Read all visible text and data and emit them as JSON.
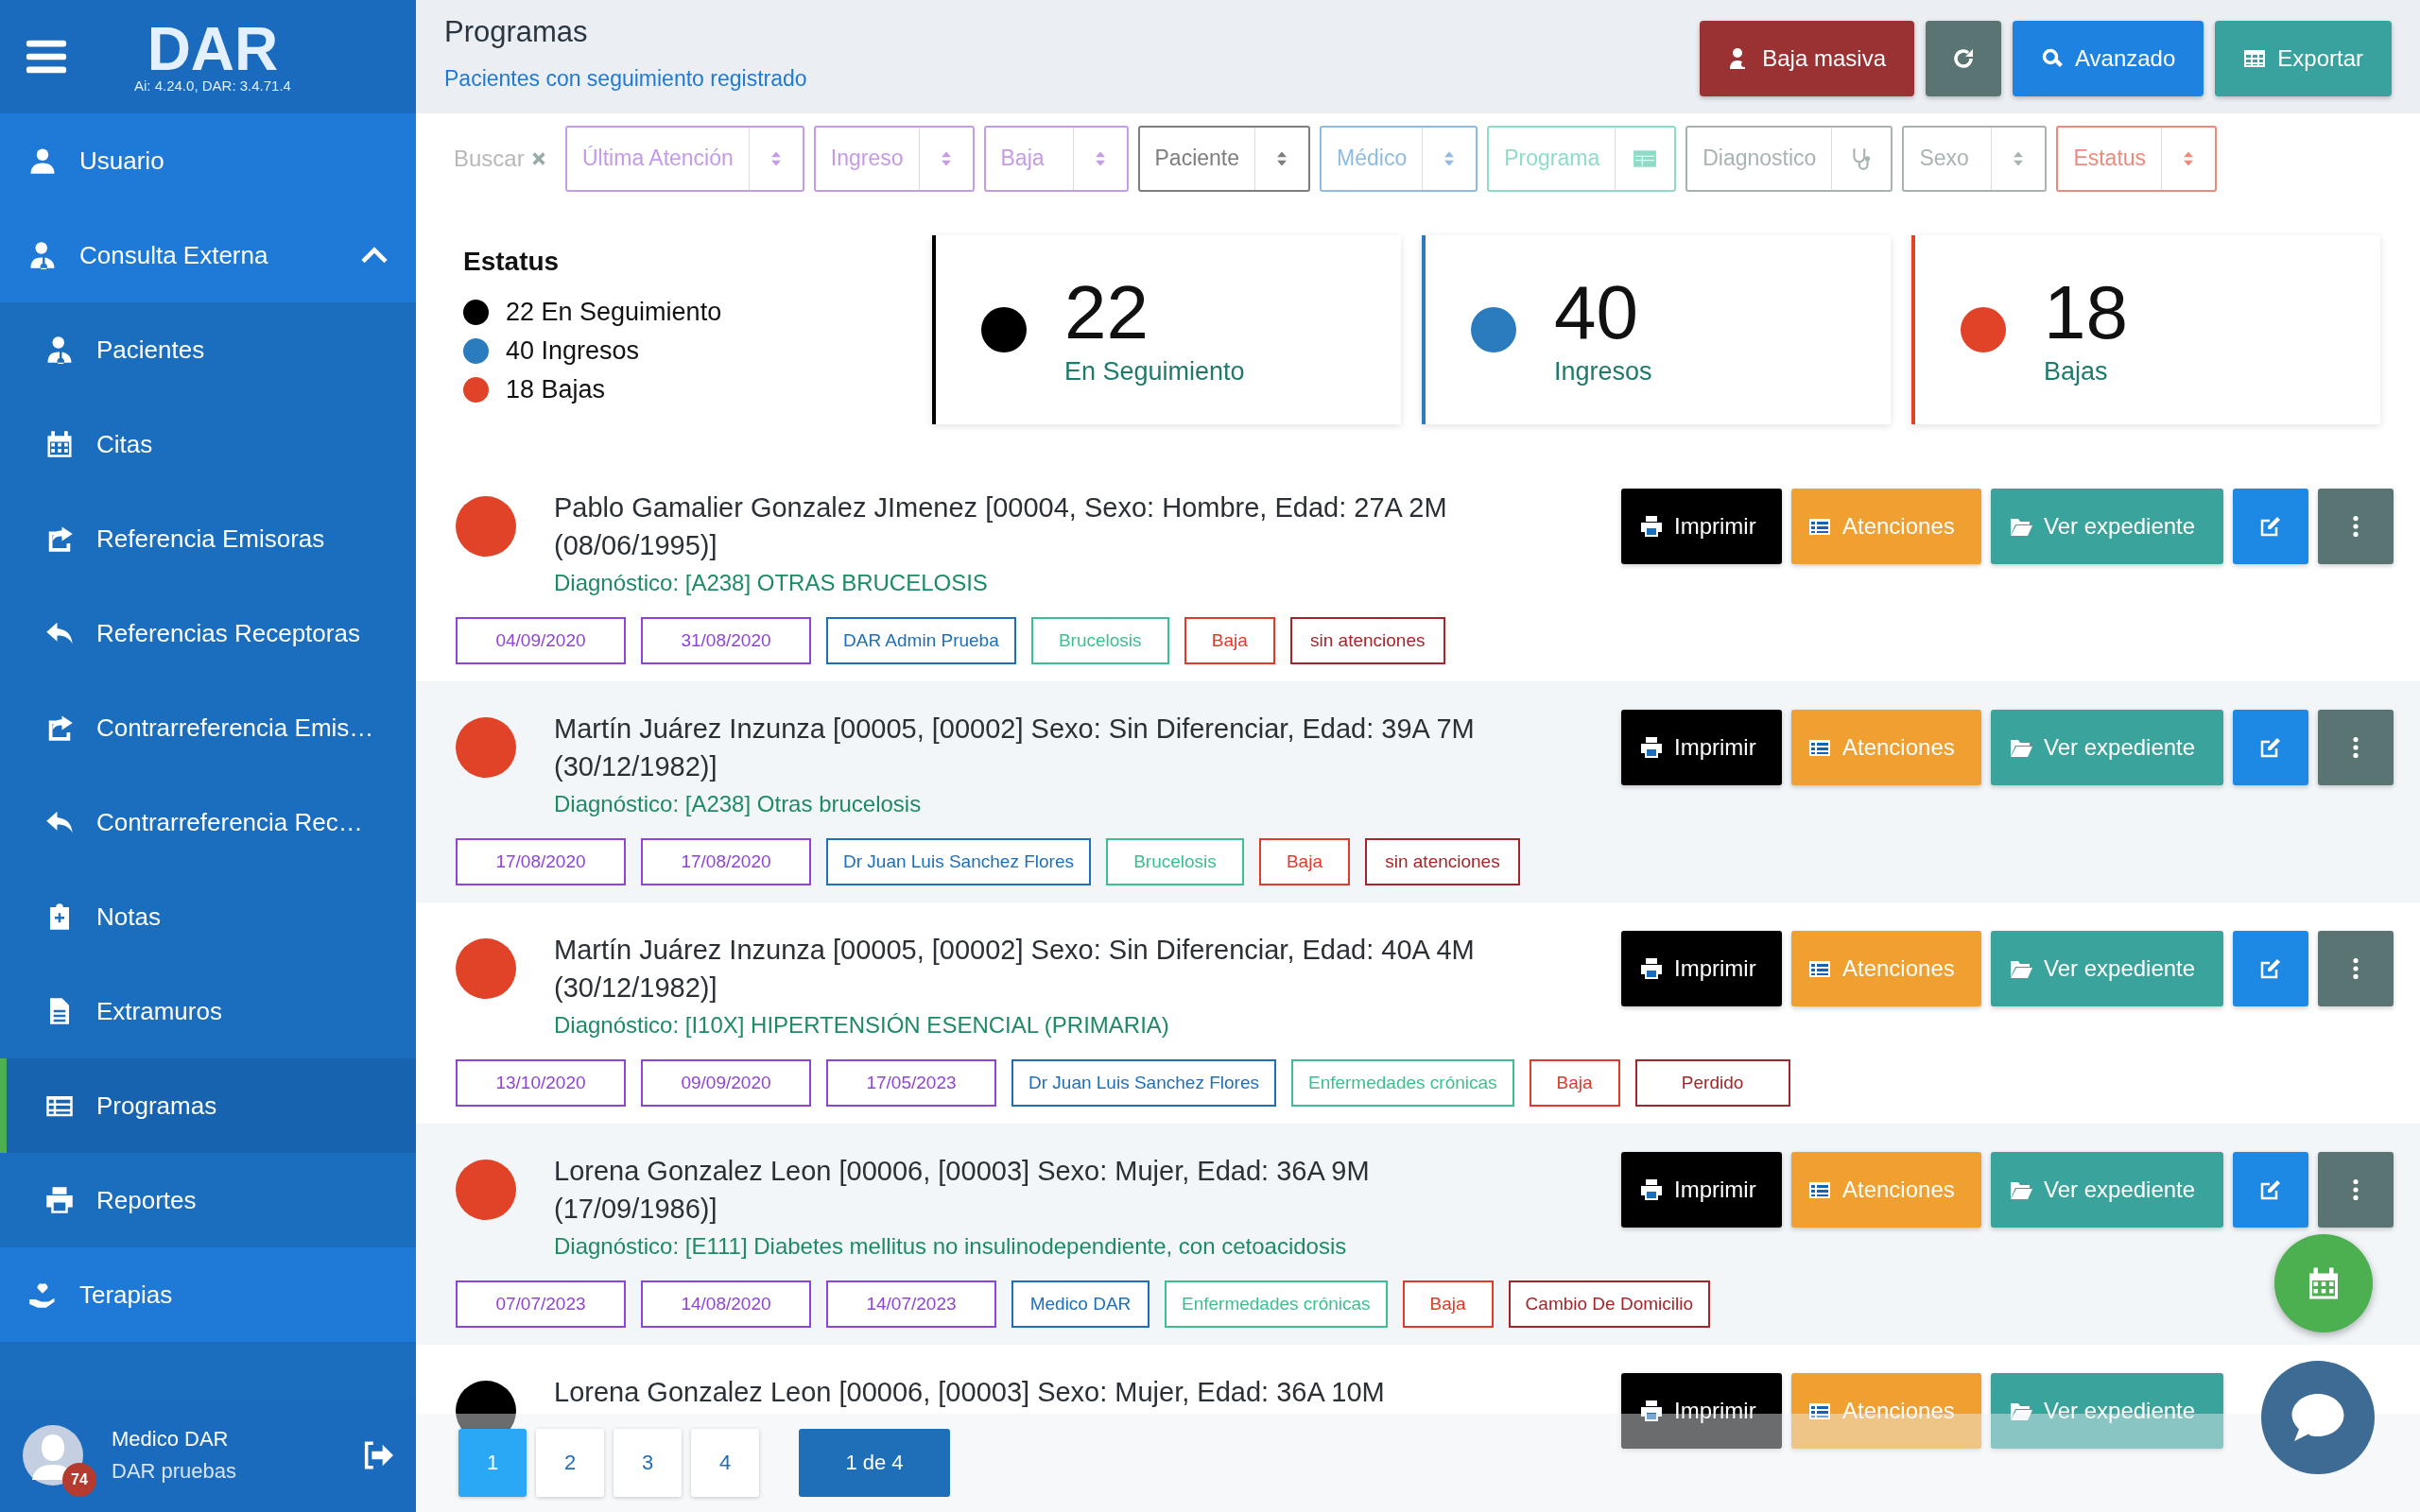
{
  "sidebar": {
    "logo": "DAR",
    "version": "Ai: 4.24.0, DAR: 3.4.71.4",
    "items": [
      {
        "label": "Usuario",
        "selected": false
      },
      {
        "label": "Consulta Externa",
        "selected": false,
        "expanded": true,
        "children": [
          {
            "label": "Pacientes",
            "selected": false
          },
          {
            "label": "Citas",
            "selected": false
          },
          {
            "label": "Referencia Emisoras",
            "selected": false
          },
          {
            "label": "Referencias Receptoras",
            "selected": false
          },
          {
            "label": "Contrarreferencia Emis…",
            "selected": false
          },
          {
            "label": "Contrarreferencia Rec…",
            "selected": false
          },
          {
            "label": "Notas",
            "selected": false
          },
          {
            "label": "Extramuros",
            "selected": false
          },
          {
            "label": "Programas",
            "selected": true
          },
          {
            "label": "Reportes",
            "selected": false
          }
        ]
      },
      {
        "label": "Terapias",
        "selected": false
      }
    ],
    "user": {
      "name": "Medico DAR",
      "org": "DAR pruebas",
      "badge": "74"
    }
  },
  "header": {
    "title": "Programas",
    "subtitle": "Pacientes con seguimiento registrado",
    "buttons": [
      {
        "kind": "bulk",
        "label": "Baja masiva"
      },
      {
        "kind": "refresh"
      },
      {
        "kind": "search",
        "label": "Avanzado"
      },
      {
        "kind": "export",
        "label": "Exportar"
      }
    ]
  },
  "filters": {
    "search": {
      "placeholder": "Buscar"
    },
    "items": [
      {
        "label": "Última Atención",
        "kind": "sort",
        "color": "#c39be6"
      },
      {
        "label": "Ingreso",
        "kind": "sort",
        "color": "#c39be6"
      },
      {
        "label": "Baja",
        "kind": "sort",
        "color": "#c39be6"
      },
      {
        "label": "Paciente",
        "kind": "sort",
        "color": "#7d7d7d"
      },
      {
        "label": "Médico",
        "kind": "sort",
        "color": "#8fbbe0"
      },
      {
        "label": "Programa",
        "kind": "card",
        "color": "#8ddcc8"
      },
      {
        "label": "Diagnostico",
        "kind": "stethoscope",
        "color": "#a9b3b3"
      },
      {
        "label": "Sexo",
        "kind": "sort",
        "color": "#a9b3b3"
      },
      {
        "label": "Estatus",
        "kind": "sort",
        "color": "#ec8a7d"
      }
    ]
  },
  "status": {
    "title": "Estatus",
    "legend": [
      {
        "label": "22 En Seguimiento",
        "color": "#000000"
      },
      {
        "label": "40 Ingresos",
        "color": "#2b7bbf"
      },
      {
        "label": "18 Bajas",
        "color": "#e04328"
      }
    ],
    "cards": [
      {
        "count": "22",
        "label": "En Seguimiento",
        "color": "#000000"
      },
      {
        "count": "40",
        "label": "Ingresos",
        "color": "#2b7bbf"
      },
      {
        "count": "18",
        "label": "Bajas",
        "color": "#e04328"
      }
    ]
  },
  "records": [
    {
      "color": "#e04328",
      "name": "Pablo Gamalier Gonzalez JImenez [00004, Sexo: Hombre, Edad: 27A 2M (08/06/1995)]",
      "diagnosis": "Diagnóstico: [A238] OTRAS BRUCELOSIS",
      "tags": [
        {
          "kind": "date",
          "label": "04/09/2020"
        },
        {
          "kind": "date",
          "label": "31/08/2020"
        },
        {
          "kind": "doctor",
          "label": "DAR Admin Prueba"
        },
        {
          "kind": "program",
          "label": "Brucelosis"
        },
        {
          "kind": "status",
          "label": "Baja"
        },
        {
          "kind": "reason",
          "label": "sin atenciones"
        }
      ],
      "actions": [
        {
          "kind": "print",
          "label": "Imprimir"
        },
        {
          "kind": "list",
          "label": "Atenciones"
        },
        {
          "kind": "folder",
          "label": "Ver expediente"
        },
        {
          "kind": "edit"
        },
        {
          "kind": "more"
        }
      ]
    },
    {
      "color": "#e04328",
      "name": "Martín Juárez Inzunza [00005, [00002] Sexo: Sin Diferenciar, Edad: 39A 7M (30/12/1982)]",
      "diagnosis": "Diagnóstico: [A238] Otras brucelosis",
      "tags": [
        {
          "kind": "date",
          "label": "17/08/2020"
        },
        {
          "kind": "date",
          "label": "17/08/2020"
        },
        {
          "kind": "doctor",
          "label": "Dr Juan Luis Sanchez Flores"
        },
        {
          "kind": "program",
          "label": "Brucelosis"
        },
        {
          "kind": "status",
          "label": "Baja"
        },
        {
          "kind": "reason",
          "label": "sin atenciones"
        }
      ],
      "actions": [
        {
          "kind": "print",
          "label": "Imprimir"
        },
        {
          "kind": "list",
          "label": "Atenciones"
        },
        {
          "kind": "folder",
          "label": "Ver expediente"
        },
        {
          "kind": "edit"
        },
        {
          "kind": "more"
        }
      ]
    },
    {
      "color": "#e04328",
      "name": "Martín Juárez Inzunza [00005, [00002] Sexo: Sin Diferenciar, Edad: 40A 4M (30/12/1982)]",
      "diagnosis": "Diagnóstico: [I10X] HIPERTENSIÓN ESENCIAL (PRIMARIA)",
      "tags": [
        {
          "kind": "date",
          "label": "13/10/2020"
        },
        {
          "kind": "date",
          "label": "09/09/2020"
        },
        {
          "kind": "date",
          "label": "17/05/2023"
        },
        {
          "kind": "doctor",
          "label": "Dr Juan Luis Sanchez Flores"
        },
        {
          "kind": "program",
          "label": "Enfermedades crónicas"
        },
        {
          "kind": "status",
          "label": "Baja"
        },
        {
          "kind": "reason",
          "label": "Perdido"
        }
      ],
      "actions": [
        {
          "kind": "print",
          "label": "Imprimir"
        },
        {
          "kind": "list",
          "label": "Atenciones"
        },
        {
          "kind": "folder",
          "label": "Ver expediente"
        },
        {
          "kind": "edit"
        },
        {
          "kind": "more"
        }
      ]
    },
    {
      "color": "#e04328",
      "name": "Lorena Gonzalez Leon [00006, [00003] Sexo: Mujer, Edad: 36A 9M (17/09/1986)]",
      "diagnosis": "Diagnóstico: [E111] Diabetes mellitus no insulinodependiente, con cetoacidosis",
      "tags": [
        {
          "kind": "date",
          "label": "07/07/2023"
        },
        {
          "kind": "date",
          "label": "14/08/2020"
        },
        {
          "kind": "date",
          "label": "14/07/2023"
        },
        {
          "kind": "doctor",
          "label": "Medico DAR"
        },
        {
          "kind": "program",
          "label": "Enfermedades crónicas"
        },
        {
          "kind": "status",
          "label": "Baja"
        },
        {
          "kind": "reason",
          "label": "Cambio De Domicilio"
        }
      ],
      "actions": [
        {
          "kind": "print",
          "label": "Imprimir"
        },
        {
          "kind": "list",
          "label": "Atenciones"
        },
        {
          "kind": "folder",
          "label": "Ver expediente"
        },
        {
          "kind": "edit"
        },
        {
          "kind": "more"
        }
      ]
    },
    {
      "color": "#000000",
      "name": "Lorena Gonzalez Leon [00006, [00003] Sexo: Mujer, Edad: 36A 10M",
      "actions": [
        {
          "kind": "print",
          "label": "Imprimir"
        },
        {
          "kind": "list",
          "label": "Atenciones"
        },
        {
          "kind": "folder",
          "label": "Ver expediente"
        }
      ]
    }
  ],
  "pagination": {
    "pages": [
      {
        "label": "1",
        "selected": true
      },
      {
        "label": "2",
        "selected": false
      },
      {
        "label": "3",
        "selected": false
      },
      {
        "label": "4",
        "selected": false
      }
    ],
    "summary": "1 de 4"
  }
}
